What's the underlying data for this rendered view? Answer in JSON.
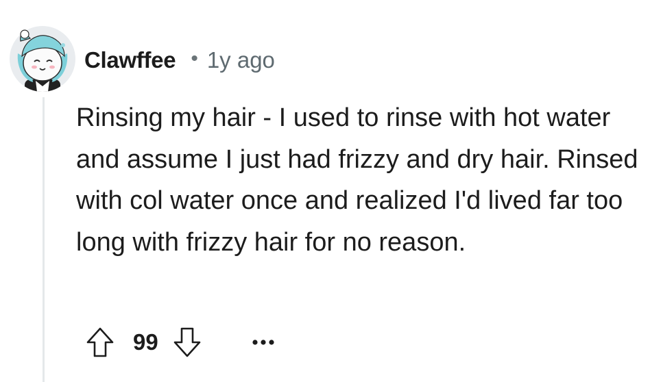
{
  "comment": {
    "author": "Clawffee",
    "separator": "•",
    "timestamp": "1y ago",
    "body": "Rinsing my hair - I used to rinse with hot water and assume I just had frizzy and dry hair. Rinsed with col water once and realized I'd lived far too long with frizzy hair for no reason.",
    "score": "99"
  },
  "icons": {
    "avatar": "snoo-avatar-cat-icon",
    "upvote": "upvote-arrow-icon",
    "downvote": "downvote-arrow-icon",
    "more": "more-options-icon"
  },
  "colors": {
    "text": "#1c1c1c",
    "meta": "#5e6a70",
    "thread_line": "#e5e8ea",
    "icon_stroke": "#1c1c1c"
  }
}
